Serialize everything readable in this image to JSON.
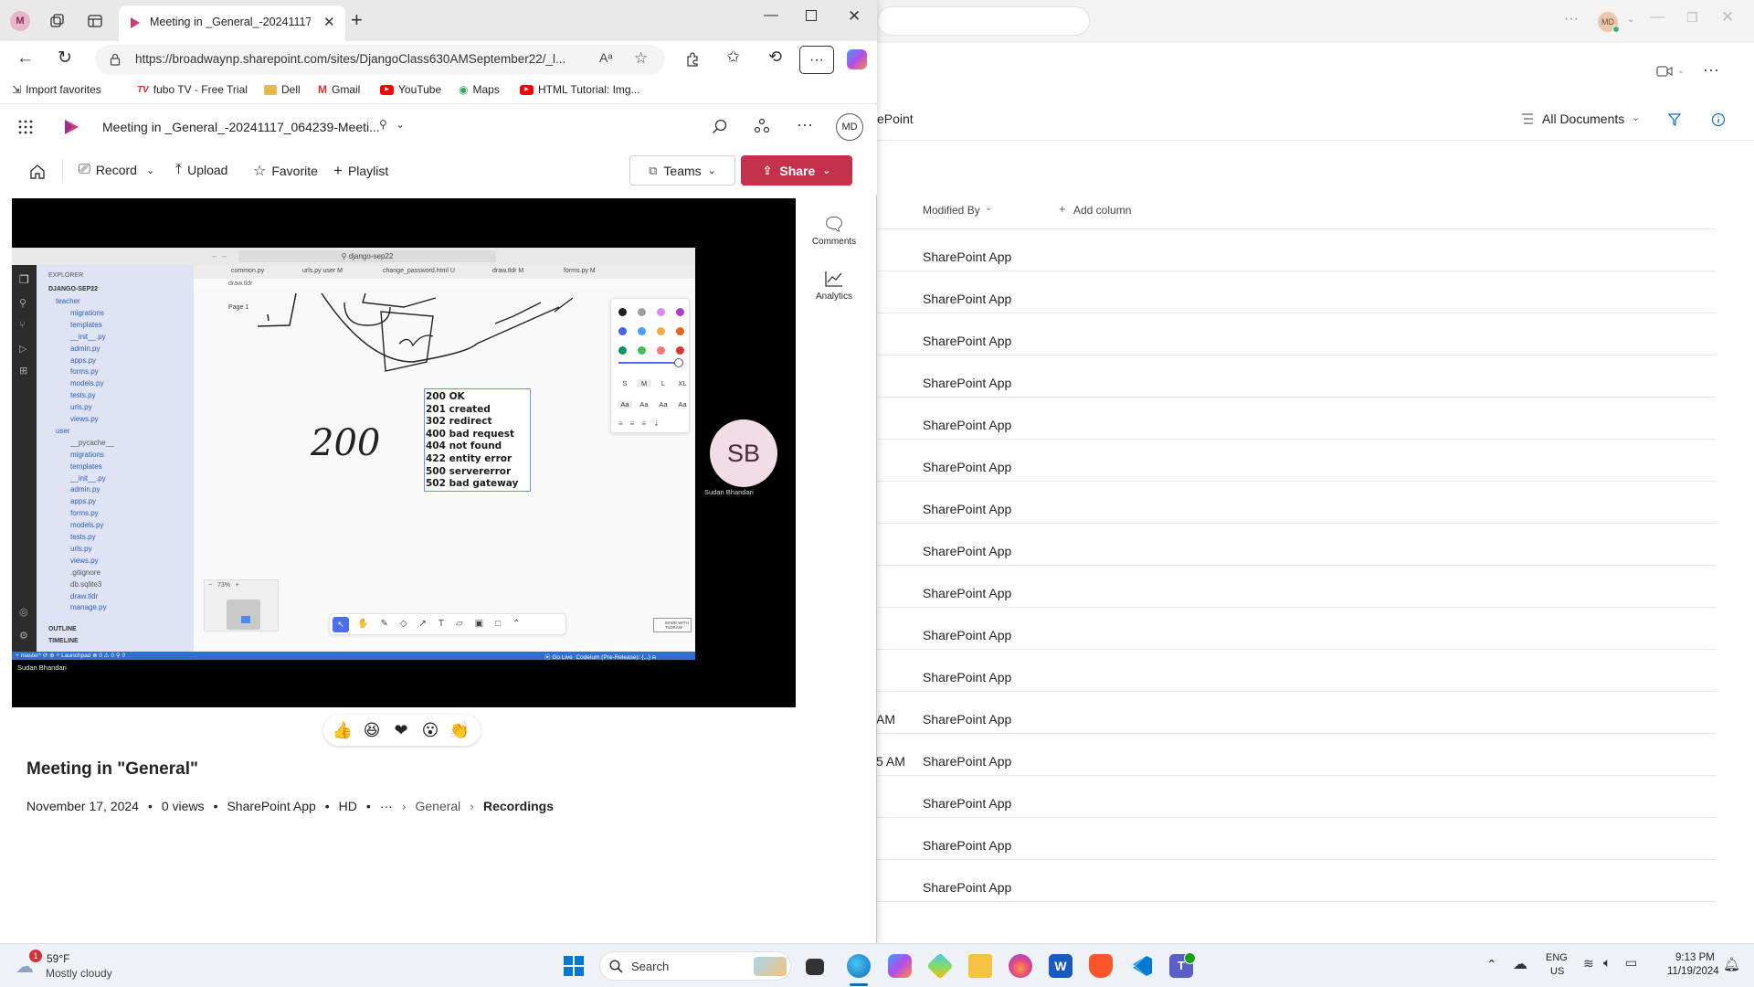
{
  "browser": {
    "profile_initial": "M",
    "tab_title": "Meeting in _General_-20241117_0",
    "url": "https://broadwaynp.sharepoint.com/sites/DjangoClass630AMSeptember22/_l...",
    "favorites": [
      "Import favorites",
      "fubo TV - Free Trial",
      "Dell",
      "Gmail",
      "YouTube",
      "Maps",
      "HTML Tutorial: Img..."
    ],
    "fubo_prefix": "TV"
  },
  "stream": {
    "file_title": "Meeting in _General_-20241117_064239-Meeti...",
    "user_initials": "MD",
    "commands": {
      "record": "Record",
      "upload": "Upload",
      "favorite": "Favorite",
      "playlist": "Playlist",
      "teams": "Teams",
      "share": "Share"
    },
    "side": {
      "comments": "Comments",
      "analytics": "Analytics"
    },
    "video_title": "Meeting in \"General\"",
    "date": "November 17, 2024",
    "views": "0 views",
    "owner": "SharePoint App",
    "quality": "HD",
    "breadcrumb": [
      "General",
      "Recordings"
    ],
    "reactions": [
      "👍",
      "😆",
      "❤",
      "😮",
      "👏"
    ]
  },
  "video_content": {
    "search_box": "django-sep22",
    "explorer_title": "EXPLORER",
    "project": "DJANGO-SEP22",
    "tabs": [
      "common.py",
      "urls.py user M",
      "change_password.html U",
      "draw.tldr M",
      "forms.py M"
    ],
    "draw_file": "draw.tldr",
    "page_label": "Page 1",
    "files": [
      {
        "name": "teacher",
        "dim": false
      },
      {
        "name": "migrations",
        "dim": false
      },
      {
        "name": "templates",
        "dim": false
      },
      {
        "name": "__init__.py",
        "dim": false
      },
      {
        "name": "admin.py",
        "dim": false
      },
      {
        "name": "apps.py",
        "dim": false
      },
      {
        "name": "forms.py",
        "dim": false
      },
      {
        "name": "models.py",
        "dim": false
      },
      {
        "name": "tests.py",
        "dim": false
      },
      {
        "name": "urls.py",
        "dim": false
      },
      {
        "name": "views.py",
        "dim": false
      },
      {
        "name": "user",
        "dim": false
      },
      {
        "name": "__pycache__",
        "dim": true
      },
      {
        "name": "migrations",
        "dim": false
      },
      {
        "name": "templates",
        "dim": false
      },
      {
        "name": "__init__.py",
        "dim": false
      },
      {
        "name": "admin.py",
        "dim": false
      },
      {
        "name": "apps.py",
        "dim": false
      },
      {
        "name": "forms.py",
        "dim": false
      },
      {
        "name": "models.py",
        "dim": false
      },
      {
        "name": "tests.py",
        "dim": false
      },
      {
        "name": "urls.py",
        "dim": false
      },
      {
        "name": "views.py",
        "dim": false
      },
      {
        "name": ".gitignore",
        "dim": true
      },
      {
        "name": "db.sqlite3",
        "dim": true
      },
      {
        "name": "draw.tldr",
        "dim": false
      },
      {
        "name": "manage.py",
        "dim": false
      }
    ],
    "status_codes": [
      "200 OK",
      "201 created",
      "302 redirect",
      "400 bad request",
      "404 not found",
      "422 entity error",
      "500 servererror",
      "502 bad gateway"
    ],
    "handwritten": "200",
    "size_options": [
      "S",
      "M",
      "L",
      "XL"
    ],
    "font_options": [
      "Aa",
      "Aa",
      "Aa",
      "Aa"
    ],
    "zoom": "73%",
    "made_with": "MADE WITH TLDRAW",
    "outline": "OUTLINE",
    "timeline": "TIMELINE",
    "status_left": "master*",
    "status_launchpad": "Launchpad",
    "status_errors": "0 ⚠ 0",
    "status_ports": "0",
    "status_golive": "Go Live",
    "status_codeium": "Codeium (Pre-Release): {...}",
    "participant_initials": "SB",
    "participant_name": "Sudan Bhandari",
    "speaker_caption": "Sudan Bhandari",
    "palette": [
      "#1e1e1e",
      "#9e9e9e",
      "#e085f4",
      "#ae3ec9",
      "#4465e9",
      "#4ba1f1",
      "#f1ac4b",
      "#e16919",
      "#099268",
      "#40c057",
      "#f87777",
      "#e03131"
    ]
  },
  "background": {
    "site_fragment": "ePoint",
    "view_name": "All Documents",
    "modified_by_header": "Modified By",
    "add_column": "Add column",
    "initials": "MD",
    "rows": [
      {
        "frag": "",
        "modified_by": "SharePoint App"
      },
      {
        "frag": "",
        "modified_by": "SharePoint App"
      },
      {
        "frag": "",
        "modified_by": "SharePoint App"
      },
      {
        "frag": "",
        "modified_by": "SharePoint App"
      },
      {
        "frag": "",
        "modified_by": "SharePoint App"
      },
      {
        "frag": "",
        "modified_by": "SharePoint App"
      },
      {
        "frag": "",
        "modified_by": "SharePoint App"
      },
      {
        "frag": "",
        "modified_by": "SharePoint App"
      },
      {
        "frag": "",
        "modified_by": "SharePoint App"
      },
      {
        "frag": "",
        "modified_by": "SharePoint App"
      },
      {
        "frag": "",
        "modified_by": "SharePoint App"
      },
      {
        "frag": "AM",
        "modified_by": "SharePoint App"
      },
      {
        "frag": "5 AM",
        "modified_by": "SharePoint App"
      },
      {
        "frag": "",
        "modified_by": "SharePoint App"
      },
      {
        "frag": "",
        "modified_by": "SharePoint App"
      },
      {
        "frag": "",
        "modified_by": "SharePoint App"
      }
    ]
  },
  "taskbar": {
    "weather_temp": "59°F",
    "weather_desc": "Mostly cloudy",
    "weather_badge": "1",
    "search_placeholder": "Search",
    "lang1": "ENG",
    "lang2": "US",
    "time": "9:13 PM",
    "date": "11/19/2024"
  },
  "colors": {
    "accent_share": "#c4314b",
    "stream_logo": "#d13a7a",
    "vscode_status": "#2e6fd0"
  }
}
